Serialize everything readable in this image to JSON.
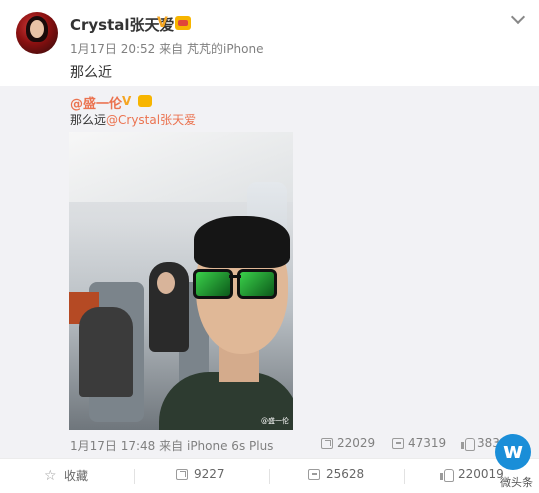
{
  "author": {
    "name": "Crystal张天爱",
    "verified_icon": "verified-v-icon",
    "member_icon": "member-crown-icon",
    "time": "1月17日 20:52",
    "via_prefix": "来自",
    "device": "芃芃的iPhone"
  },
  "post": {
    "text": "那么近"
  },
  "repost": {
    "user": "@盛一伦",
    "text_prefix": "那么远",
    "mention": "@Crystal张天爱",
    "photo_watermark": "@盛一伦",
    "time": "1月17日 17:48",
    "via_prefix": "来自",
    "device": "iPhone 6s Plus",
    "stats": {
      "shares": "22029",
      "comments": "47319",
      "likes": "3832"
    }
  },
  "footer": {
    "favorite_label": "收藏",
    "shares": "9227",
    "comments": "25628",
    "likes": "220019"
  },
  "watermark": {
    "logo": "w",
    "label": "微头条"
  },
  "colors": {
    "link": "#eb7350",
    "meta": "#808080",
    "repost_bg": "#f2f2f5"
  }
}
